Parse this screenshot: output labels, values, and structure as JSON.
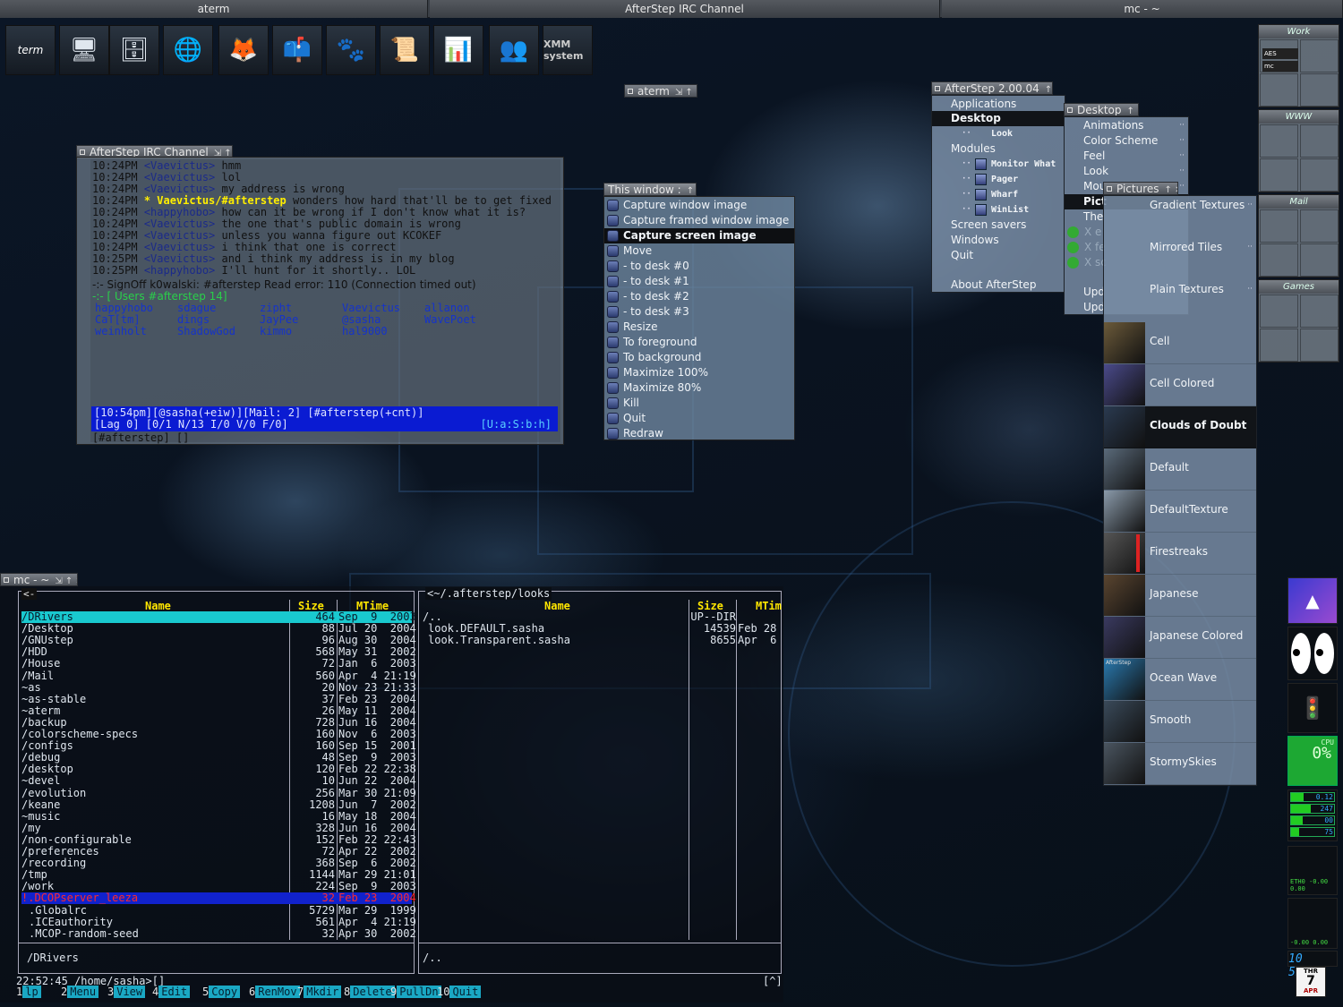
{
  "topbar": {
    "left": "aterm",
    "center": "AfterStep IRC Channel",
    "right": "mc - ~"
  },
  "launcher": [
    {
      "label": "term",
      "icon": "terminal-icon"
    },
    {
      "label": "",
      "icon": "monitor-icon"
    },
    {
      "label": "",
      "icon": "file-cabinet-icon"
    },
    {
      "label": "",
      "icon": "network-globe-icon"
    },
    {
      "label": "",
      "icon": "firefox-icon"
    },
    {
      "label": "",
      "icon": "mailbox-icon"
    },
    {
      "label": "",
      "icon": "gimp-icon"
    },
    {
      "label": "",
      "icon": "scroll-icon"
    },
    {
      "label": "",
      "icon": "spreadsheet-icon"
    },
    {
      "label": "",
      "icon": "people-icon"
    },
    {
      "label": "XMM system",
      "icon": "xmms-icon"
    }
  ],
  "aterm_title": "aterm",
  "irc": {
    "title": "AfterStep IRC Channel",
    "lines": [
      [
        "10:24PM",
        "<Vaevictus>",
        "hmm"
      ],
      [
        "10:24PM",
        "<Vaevictus>",
        "lol"
      ],
      [
        "10:24PM",
        "<Vaevictus>",
        "my address is wrong"
      ],
      [
        "10:24PM",
        "* Vaevictus/#afterstep",
        "wonders how hard that'll be to get fixed"
      ],
      [
        "10:24PM",
        "<happyhobo>",
        "how can it be wrong if I don't know what it is?"
      ],
      [
        "10:24PM",
        "<Vaevictus>",
        "the one that's public domain is wrong"
      ],
      [
        "10:24PM",
        "<Vaevictus>",
        "unless you wanna figure out KCOKEF"
      ],
      [
        "10:24PM",
        "<Vaevictus>",
        "i think that one is correct"
      ],
      [
        "10:25PM",
        "<Vaevictus>",
        "and i think my address is in my blog"
      ],
      [
        "10:25PM",
        "<happyhobo>",
        "I'll hunt for it shortly.. LOL"
      ]
    ],
    "signoff": "-:- SignOff k0walski: #afterstep  Read error: 110 (Connection timed out)",
    "users_line": "-:- [ Users #afterstep 14]",
    "nicks": [
      [
        "happyhobo",
        "sdague",
        "zipht",
        "Vaevictus",
        "allanon"
      ],
      [
        "CaT[tm]",
        "dings",
        "JayPee",
        "@sasha",
        "WavePoet"
      ],
      [
        "weinholt",
        "ShadowGod",
        "kimmo",
        "hal9000",
        ""
      ]
    ],
    "status1": "[10:54pm][@sasha(+eiw)][Mail: 2] [#afterstep(+cnt)]",
    "status2": "[Lag  0] [0/1 N/13 I/0 V/0 F/0]",
    "status2_right": "[U:a:S:b:h]",
    "input": "[#afterstep] []"
  },
  "this_window": {
    "title": "This window :",
    "items": [
      {
        "label": "Capture window image",
        "icon": "camera-icon"
      },
      {
        "label": "Capture framed window image",
        "icon": "camera-icon"
      },
      {
        "label": "Capture screen image",
        "icon": "camera-icon",
        "selected": true
      },
      {
        "label": "Move",
        "icon": "move-icon"
      },
      {
        "label": "- to desk #0",
        "icon": "desk-icon"
      },
      {
        "label": "- to desk #1",
        "icon": "desk-icon"
      },
      {
        "label": "- to desk #2",
        "icon": "desk-icon"
      },
      {
        "label": "- to desk #3",
        "icon": "desk-icon"
      },
      {
        "label": "Resize",
        "icon": "resize-icon"
      },
      {
        "label": "To foreground",
        "icon": "raise-icon"
      },
      {
        "label": "To background",
        "icon": "lower-icon"
      },
      {
        "label": "Maximize 100%",
        "icon": "maximize-icon"
      },
      {
        "label": "Maximize 80%",
        "icon": "maximize-icon"
      },
      {
        "label": "Kill",
        "icon": "kill-icon"
      },
      {
        "label": "Quit",
        "icon": "quit-icon"
      },
      {
        "label": "Redraw",
        "icon": "redraw-icon"
      }
    ]
  },
  "afterstep_menu": {
    "title": "AfterStep 2.00.04",
    "items": [
      "Applications",
      "Desktop",
      "Look",
      "Modules",
      "Monitor What",
      "Pager",
      "Wharf",
      "WinList",
      "Screen savers",
      "Windows",
      "Quit",
      "About AfterStep"
    ]
  },
  "desktop_menu": {
    "title": "Desktop",
    "items": [
      "Animations",
      "Color Scheme",
      "Feel",
      "Look",
      "Mou",
      "Pict",
      "The",
      "X e",
      "X fe",
      "X sc",
      "Upd",
      "Upd"
    ]
  },
  "pictures_menu": {
    "title": "Pictures",
    "top": [
      "Gradient Textures",
      "Mirrored Tiles",
      "Plain Textures"
    ],
    "items": [
      "Cell",
      "Cell Colored",
      "Clouds of Doubt",
      "Default",
      "DefaultTexture",
      "Firestreaks",
      "Japanese",
      "Japanese Colored",
      "Ocean Wave",
      "Smooth",
      "StormySkies"
    ],
    "selected": "Clouds of Doubt",
    "ocean_wave_thumb_text": "AfterStep"
  },
  "pager": [
    {
      "name": "Work",
      "labels": [
        "AES",
        "mc"
      ]
    },
    {
      "name": "WWW",
      "labels": []
    },
    {
      "name": "Mail",
      "labels": []
    },
    {
      "name": "Games",
      "labels": []
    }
  ],
  "dock": {
    "cpu_label": "CPU",
    "cpu_value": "0%",
    "meters": [
      "0.12",
      "247",
      "00",
      "75"
    ],
    "net1": "ETH0 -0.00 0.00",
    "net2": "-0.00 0.00",
    "clock": "10 53PM",
    "day": "THR",
    "date": "7",
    "month": "APR"
  },
  "mc": {
    "title": "mc - ~",
    "left_path": "",
    "right_path": "<~/.afterstep/looks",
    "columns": {
      "name": "Name",
      "size": "Size",
      "mtime": "MTime"
    },
    "right_columns": {
      "name": "Name",
      "size": "Size",
      "mtime": "MTim"
    },
    "left_rows": [
      [
        "/DRivers",
        "464",
        "Sep  9  2003"
      ],
      [
        "/Desktop",
        "88",
        "Jul 20  2004"
      ],
      [
        "/GNUstep",
        "96",
        "Aug 30  2004"
      ],
      [
        "/HDD",
        "568",
        "May 31  2002"
      ],
      [
        "/House",
        "72",
        "Jan  6  2003"
      ],
      [
        "/Mail",
        "560",
        "Apr  4 21:19"
      ],
      [
        "~as",
        "20",
        "Nov 23 21:33"
      ],
      [
        "~as-stable",
        "37",
        "Feb 23  2004"
      ],
      [
        "~aterm",
        "26",
        "May 11  2004"
      ],
      [
        "/backup",
        "728",
        "Jun 16  2004"
      ],
      [
        "/colorscheme-specs",
        "160",
        "Nov  6  2003"
      ],
      [
        "/configs",
        "160",
        "Sep 15  2001"
      ],
      [
        "/debug",
        "48",
        "Sep  9  2003"
      ],
      [
        "/desktop",
        "120",
        "Feb 22 22:38"
      ],
      [
        "~devel",
        "10",
        "Jun 22  2004"
      ],
      [
        "/evolution",
        "256",
        "Mar 30 21:09"
      ],
      [
        "/keane",
        "1208",
        "Jun  7  2002"
      ],
      [
        "~music",
        "16",
        "May 18  2004"
      ],
      [
        "/my",
        "328",
        "Jun 16  2004"
      ],
      [
        "/non-configurable",
        "152",
        "Feb 22 22:43"
      ],
      [
        "/preferences",
        "72",
        "Apr 22  2002"
      ],
      [
        "/recording",
        "368",
        "Sep  6  2002"
      ],
      [
        "/tmp",
        "1144",
        "Mar 29 21:01"
      ],
      [
        "/work",
        "224",
        "Sep  9  2003"
      ],
      [
        "!.DCOPserver_leeza",
        "32",
        "Feb 23  2004"
      ],
      [
        ".Globalrc",
        "5729",
        "Mar 29  1999"
      ],
      [
        ".ICEauthority",
        "561",
        "Apr  4 21:19"
      ],
      [
        ".MCOP-random-seed",
        "32",
        "Apr 30  2002"
      ]
    ],
    "right_rows": [
      [
        "/..",
        "UP--DIR",
        ""
      ],
      [
        "look.DEFAULT.sasha",
        "14539",
        "Feb 28"
      ],
      [
        "look.Transparent.sasha",
        "8655",
        "Apr  6"
      ]
    ],
    "left_footer": "/DRivers",
    "right_footer": "/..",
    "prompt": "22:52:45 /home/sasha>[]",
    "prompt_right": "[^]",
    "fkeys": [
      [
        "1",
        "lp"
      ],
      [
        "2",
        "Menu"
      ],
      [
        "3",
        "View"
      ],
      [
        "4",
        "Edit"
      ],
      [
        "5",
        "Copy"
      ],
      [
        "6",
        "RenMov"
      ],
      [
        "7",
        "Mkdir"
      ],
      [
        "8",
        "Delete"
      ],
      [
        "9",
        "PullDn"
      ],
      [
        "10",
        "Quit"
      ]
    ]
  }
}
